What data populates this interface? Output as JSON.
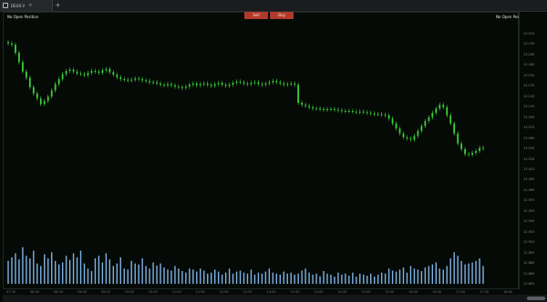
{
  "tab": {
    "label": "DEUX.V",
    "close_glyph": "×",
    "icon": "window-icon"
  },
  "add_tab_glyph": "+",
  "order_buttons": {
    "sell": "Sell",
    "buy": "Buy"
  },
  "position_labels": {
    "left": "No Open Position",
    "right": "No Open Position"
  },
  "colors": {
    "candle": "#3bd13b",
    "volume": "#7fb2e5",
    "order_button": "#b23a2a",
    "background": "#050a06"
  },
  "chart_data": {
    "type": "candlestick",
    "title": "",
    "close": [
      40,
      39.8,
      38.5,
      37,
      35.5,
      34.5,
      33,
      32,
      31.2,
      30.3,
      30.8,
      31.5,
      32.5,
      33.5,
      34.3,
      35.1,
      35.6,
      35.8,
      35.5,
      35.2,
      35.1,
      34.9,
      35.3,
      35.6,
      35.5,
      35.3,
      35.7,
      35.9,
      35.4,
      35,
      34.6,
      34.3,
      34.2,
      34.1,
      34.2,
      34.4,
      34.3,
      34.1,
      34,
      33.8,
      33.8,
      33.6,
      33.4,
      33.3,
      33.5,
      33.3,
      33.1,
      33,
      32.9,
      33.1,
      33.4,
      33.6,
      33.3,
      33.5,
      33.6,
      33.4,
      33.2,
      33.5,
      33.7,
      33.4,
      33.2,
      33.4,
      33.7,
      33.9,
      33.8,
      33.6,
      33.5,
      33.7,
      33.8,
      33.5,
      33.4,
      33.6,
      33.8,
      34,
      33.8,
      33.6,
      33.4,
      33.5,
      33.6,
      33.4,
      30.5,
      30.2,
      30,
      29.8,
      29.6,
      29.6,
      29.5,
      29.4,
      29.5,
      29.5,
      29.4,
      29.3,
      29.2,
      29.2,
      29.2,
      29.1,
      29,
      29.1,
      29,
      28.9,
      28.8,
      28.7,
      28.7,
      28.6,
      28.5,
      28,
      27.2,
      26.4,
      25.6,
      25,
      24.8,
      24.6,
      25.2,
      26,
      26.8,
      27.6,
      28.2,
      28.9,
      29.6,
      30.2,
      29.8,
      28.5,
      27.2,
      25.6,
      24,
      23.1,
      22.3,
      22.2,
      22.5,
      22.8,
      23.3,
      23.2
    ],
    "volume": [
      0.45,
      0.52,
      0.6,
      0.48,
      0.72,
      0.55,
      0.5,
      0.65,
      0.4,
      0.35,
      0.58,
      0.5,
      0.62,
      0.45,
      0.38,
      0.42,
      0.55,
      0.47,
      0.6,
      0.52,
      0.65,
      0.4,
      0.3,
      0.25,
      0.5,
      0.55,
      0.42,
      0.6,
      0.48,
      0.35,
      0.4,
      0.52,
      0.3,
      0.28,
      0.45,
      0.4,
      0.38,
      0.5,
      0.35,
      0.3,
      0.42,
      0.36,
      0.4,
      0.32,
      0.28,
      0.26,
      0.35,
      0.3,
      0.25,
      0.22,
      0.3,
      0.28,
      0.24,
      0.3,
      0.26,
      0.2,
      0.22,
      0.28,
      0.24,
      0.18,
      0.22,
      0.3,
      0.2,
      0.24,
      0.26,
      0.22,
      0.2,
      0.28,
      0.18,
      0.22,
      0.2,
      0.24,
      0.3,
      0.22,
      0.2,
      0.18,
      0.24,
      0.2,
      0.22,
      0.18,
      0.2,
      0.26,
      0.3,
      0.22,
      0.18,
      0.2,
      0.15,
      0.25,
      0.2,
      0.18,
      0.14,
      0.22,
      0.18,
      0.2,
      0.16,
      0.22,
      0.14,
      0.2,
      0.18,
      0.16,
      0.2,
      0.14,
      0.18,
      0.22,
      0.2,
      0.3,
      0.26,
      0.24,
      0.28,
      0.32,
      0.22,
      0.35,
      0.3,
      0.28,
      0.25,
      0.32,
      0.35,
      0.38,
      0.42,
      0.3,
      0.28,
      0.35,
      0.5,
      0.62,
      0.55,
      0.45,
      0.38,
      0.4,
      0.42,
      0.45,
      0.5,
      0.35
    ],
    "price_ticks": [
      "13.210",
      "13.195",
      "13.180",
      "13.165",
      "13.150",
      "13.135",
      "13.120",
      "13.105",
      "13.090",
      "13.075",
      "13.060",
      "13.045",
      "13.030",
      "13.015",
      "13.000",
      "12.985",
      "12.970",
      "12.955",
      "12.940",
      "12.925",
      "12.910",
      "12.895",
      "12.880",
      "12.865",
      "12.850"
    ],
    "time_ticks": [
      "07:30",
      "08:00",
      "08:30",
      "09:00",
      "09:30",
      "10:00",
      "10:30",
      "11:00",
      "11:30",
      "12:00",
      "12:30",
      "13:00",
      "13:30",
      "14:00",
      "14:30",
      "15:00",
      "15:30",
      "16:00",
      "16:30",
      "17:00",
      "17:30",
      "18:00"
    ],
    "ylim": [
      10,
      42
    ],
    "vol_max": 0.75,
    "grid": false
  }
}
